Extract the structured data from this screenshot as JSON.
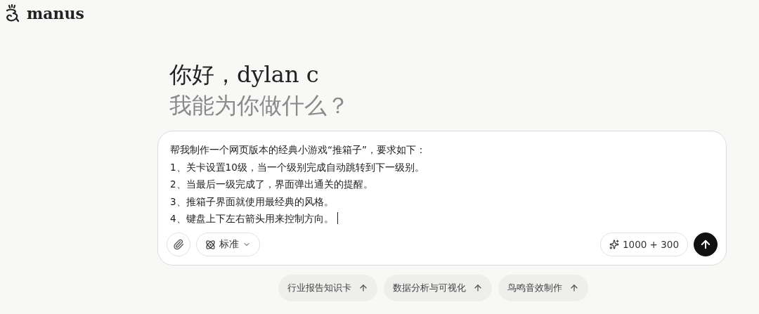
{
  "logo": {
    "text": "manus"
  },
  "greeting": {
    "line_1": "你好，dylan c",
    "line_2": "我能为你做什么？"
  },
  "input": {
    "value": "帮我制作一个网页版本的经典小游戏“推箱子”，要求如下：\n1、关卡设置10级，当一个级别完成自动跳转到下一级别。\n2、当最后一级完成了，界面弹出通关的提醒。\n3、推箱子界面就使用最经典的风格。\n4、键盘上下左右箭头用来控制方向。",
    "focused": true
  },
  "mode_button": {
    "label": "标准"
  },
  "credits": {
    "text": "1000 + 300"
  },
  "suggestions": [
    {
      "label": "行业报告知识卡"
    },
    {
      "label": "数据分析与可视化"
    },
    {
      "label": "鸟鸣音效制作"
    }
  ]
}
